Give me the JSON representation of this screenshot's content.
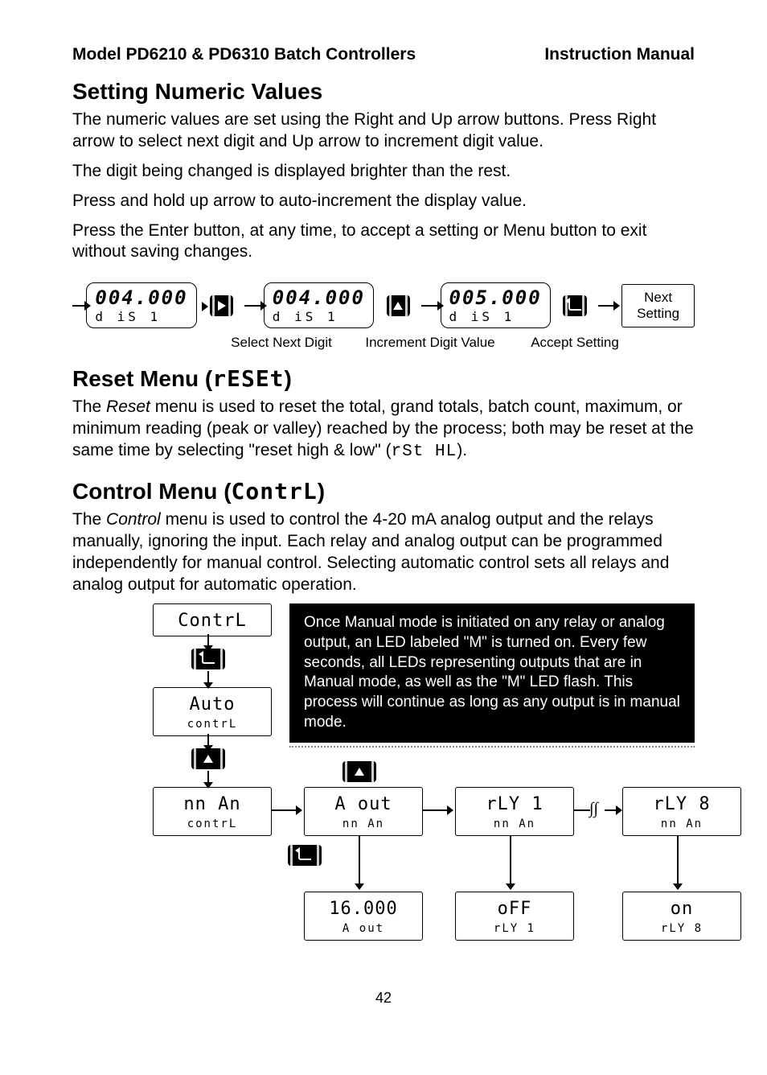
{
  "header": {
    "left": "Model PD6210 & PD6310 Batch Controllers",
    "right": "Instruction Manual"
  },
  "section1": {
    "title": "Setting Numeric Values",
    "para1": "The numeric values are set using the Right and Up arrow buttons. Press Right arrow to select next digit and Up arrow to increment digit value.",
    "para2": "The digit being changed is displayed brighter than the rest.",
    "para3": "Press and hold up arrow to auto-increment the display value.",
    "para4": "Press the Enter button, at any time, to accept a setting or Menu button to exit without saving changes."
  },
  "numericFlow": {
    "box1": {
      "line1": "004.000",
      "line2": "d iS  1"
    },
    "box2": {
      "line1": "004.000",
      "line2": "d iS  1"
    },
    "box3": {
      "line1": "005.000",
      "line2": "d iS  1"
    },
    "nextBox": "Next Setting",
    "label1": "Select Next Digit",
    "label2": "Increment Digit Value",
    "label3": "Accept Setting"
  },
  "section2": {
    "title_prefix": "Reset Menu (",
    "title_seg": "rESEt",
    "title_suffix": ")",
    "para_before_italic": "The ",
    "para_italic": "Reset",
    "para_after_italic": " menu is used to reset the total, grand totals, batch count, maximum, or minimum reading (peak or valley) reached by the process; both may be reset at the same time by selecting \"reset high & low\" (",
    "para_seg": "rSt HL",
    "para_end": ")."
  },
  "section3": {
    "title_prefix": "Control Menu (",
    "title_seg": "ContrL",
    "title_suffix": ")",
    "para_before_italic": "The ",
    "para_italic": "Control",
    "para_after_italic": " menu is used to control the 4-20 mA analog output and the relays manually, ignoring the input. Each relay and analog output can be programmed independently for manual control. Selecting automatic control sets all relays and analog output for automatic operation.",
    "callout": "Once Manual mode is initiated on any relay or analog output, an LED labeled \"M\" is turned on. Every few seconds, all LEDs representing outputs that are in Manual mode, as well as the \"M\" LED flash. This process will continue as long as any output is in manual mode."
  },
  "ctrlFlow": {
    "boxContrl": {
      "m1": "ContrL"
    },
    "boxAuto": {
      "m1": "Auto",
      "m2": "contrL"
    },
    "boxManCtl": {
      "m1": "nn An",
      "m2": "contrL"
    },
    "boxAout": {
      "m1": "A out",
      "m2": "nn An"
    },
    "boxRly1": {
      "m1": "rLY  1",
      "m2": "nn An"
    },
    "boxRly8": {
      "m1": "rLY  8",
      "m2": "nn An"
    },
    "box16": {
      "m1": "16.000",
      "m2": "A out"
    },
    "boxOff": {
      "m1": "oFF",
      "m2": "rLY  1"
    },
    "boxOn": {
      "m1": "on",
      "m2": "rLY  8"
    }
  },
  "pageNumber": "42"
}
